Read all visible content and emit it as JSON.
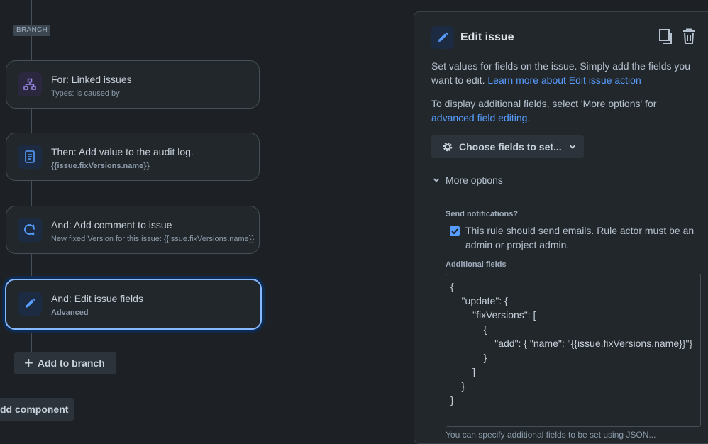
{
  "flow": {
    "branch_tag": "BRANCH",
    "cards": [
      {
        "title": "For: Linked issues",
        "subtitle": "Types: is caused by",
        "icon": "hierarchy-icon"
      },
      {
        "title": "Then: Add value to the audit log.",
        "subtitle": "{{issue.fixVersions.name}}",
        "icon": "document-icon"
      },
      {
        "title": "And: Add comment to issue",
        "subtitle": "New fixed Version for this issue: {{issue.fixVersions.name}}",
        "icon": "comment-add-icon"
      },
      {
        "title": "And: Edit issue fields",
        "subtitle": "Advanced",
        "icon": "pencil-icon"
      }
    ],
    "add_to_branch_label": "Add to branch",
    "add_component_label": "dd component"
  },
  "panel": {
    "title": "Edit issue",
    "description": "Set values for fields on the issue. Simply add the fields you want to edit.",
    "description_line1": "Set values for fields on the issue. Simply add the fields you",
    "description_line2": "want to edit.",
    "learn_more_link": "Learn more about Edit issue action",
    "additional_info_line1": "To display additional fields, select 'More options' for",
    "advanced_link": "advanced field editing",
    "advanced_suffix": ".",
    "choose_fields_label": "Choose fields to set...",
    "more_options_label": "More options",
    "send_notifications_label": "Send notifications?",
    "send_notifications_checked": true,
    "checkbox_text_line1": "This rule should send emails. Rule actor must be an",
    "checkbox_text_line2": "admin or project admin.",
    "additional_fields_label": "Additional fields",
    "json_lines": [
      "{",
      "    \"update\": {",
      "        \"fixVersions\": [",
      "            {",
      "                \"add\": { \"name\": \"{{issue.fixVersions.name}}\"}",
      "            }",
      "        ]",
      "    }",
      "}"
    ],
    "footer_partial": "You can specify additional fields to be set using JSON..."
  },
  "colors": {
    "background": "#1d2125",
    "accent": "#579dff",
    "selected_border": "#85b8ff"
  }
}
